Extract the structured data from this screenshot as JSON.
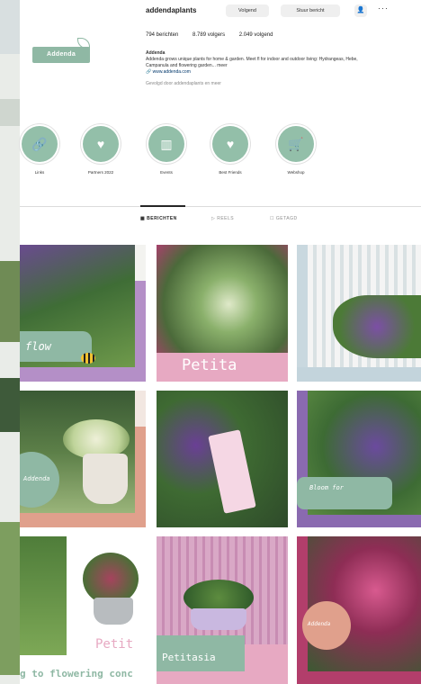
{
  "profile": {
    "username": "addendaplants",
    "avatar_text": "Addenda",
    "buttons": {
      "following": "Volgend",
      "message": "Stuur bericht"
    },
    "more": "···",
    "stats": {
      "posts": "794 berichten",
      "followers": "8.789 volgers",
      "following": "2.049 volgend"
    },
    "bio": {
      "name": "Addenda",
      "line1": "Addenda grows unique plants for home & garden. Meet fl for indoor and outdoor living: Hydrangeas, Hebe,",
      "line2": "Campanula and flowering garden... meer",
      "link": "www.addenda.com",
      "followed_by": "Gevolgd door addendaplants en meer"
    }
  },
  "highlights": [
    {
      "label": "Links",
      "icon": "link-icon",
      "glyph": "🔗"
    },
    {
      "label": "Partners 2022",
      "icon": "heart-icon",
      "glyph": "♥"
    },
    {
      "label": "Events",
      "icon": "chart-icon",
      "glyph": "▥"
    },
    {
      "label": "Best Friends",
      "icon": "heart-icon",
      "glyph": "♥"
    },
    {
      "label": "Webshop",
      "icon": "cart-icon",
      "glyph": "🛒"
    }
  ],
  "tabs": [
    {
      "label": "BERICHTEN",
      "active": true
    },
    {
      "label": "REELS",
      "active": false
    },
    {
      "label": "GETAGD",
      "active": false
    }
  ],
  "posts": [
    {
      "overlay": "flow"
    },
    {
      "overlay": "Petita"
    },
    {
      "overlay": ""
    },
    {
      "overlay": "Addenda"
    },
    {
      "overlay": ""
    },
    {
      "overlay": "Bloom for"
    },
    {
      "overlay": "Petit"
    },
    {
      "overlay": "Petitasia"
    },
    {
      "overlay": "Addenda"
    }
  ],
  "caption_bottom": "g to flowering conc",
  "colors": {
    "brand": "#93bfa9",
    "pink": "#e7a9c2",
    "lavender": "#b48fc7",
    "salmon": "#e0a08c"
  }
}
